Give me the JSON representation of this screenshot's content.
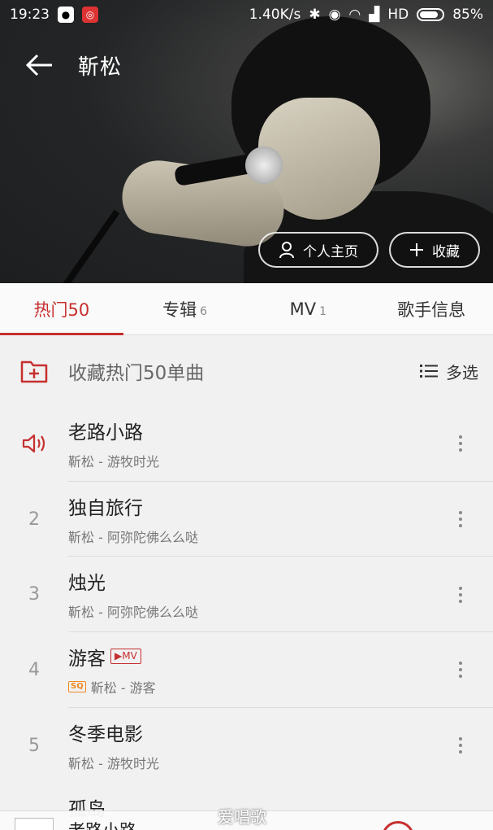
{
  "status": {
    "time": "19:23",
    "speed": "1.40K/s",
    "network": "HD",
    "battery": "85%"
  },
  "header": {
    "title": "靳松",
    "profile_label": "个人主页",
    "collect_label": "收藏"
  },
  "tabs": [
    {
      "label": "热门50",
      "count": ""
    },
    {
      "label": "专辑",
      "count": "6"
    },
    {
      "label": "MV",
      "count": "1"
    },
    {
      "label": "歌手信息",
      "count": ""
    }
  ],
  "list_header": {
    "label": "收藏热门50单曲",
    "multi_label": "多选"
  },
  "songs": [
    {
      "index": "",
      "title": "老路小路",
      "subtitle": "靳松 - 游牧时光",
      "playing": true
    },
    {
      "index": "2",
      "title": "独自旅行",
      "subtitle": "靳松 - 阿弥陀佛么么哒"
    },
    {
      "index": "3",
      "title": "烛光",
      "subtitle": "靳松 - 阿弥陀佛么么哒"
    },
    {
      "index": "4",
      "title": "游客",
      "subtitle": "靳松 - 游客",
      "mv": "MV",
      "sq": "SQ"
    },
    {
      "index": "5",
      "title": "冬季电影",
      "subtitle": "靳松 - 游牧时光"
    }
  ],
  "partial_song": "孤岛",
  "mini_player": {
    "title": "老路小路"
  },
  "watermark": "爱唱歌",
  "colors": {
    "accent": "#c62f2f"
  }
}
